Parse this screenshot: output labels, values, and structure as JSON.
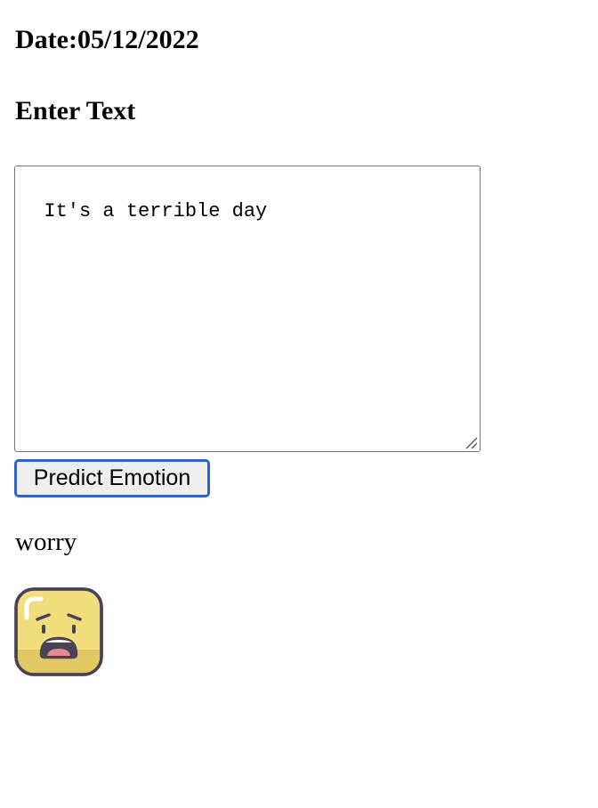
{
  "page": {
    "date_heading": "Date:05/12/2022",
    "enter_heading": "Enter Text"
  },
  "input": {
    "value": "It's a terrible day"
  },
  "predict_button": {
    "label": "Predict Emotion"
  },
  "result": {
    "emotion": "worry",
    "icon": "worried-face-icon"
  },
  "colors": {
    "button_border": "#2f62c6",
    "emoji_face": "#f1de7c",
    "emoji_outline": "#4a4257",
    "emoji_mouth": "#e58b8f"
  }
}
